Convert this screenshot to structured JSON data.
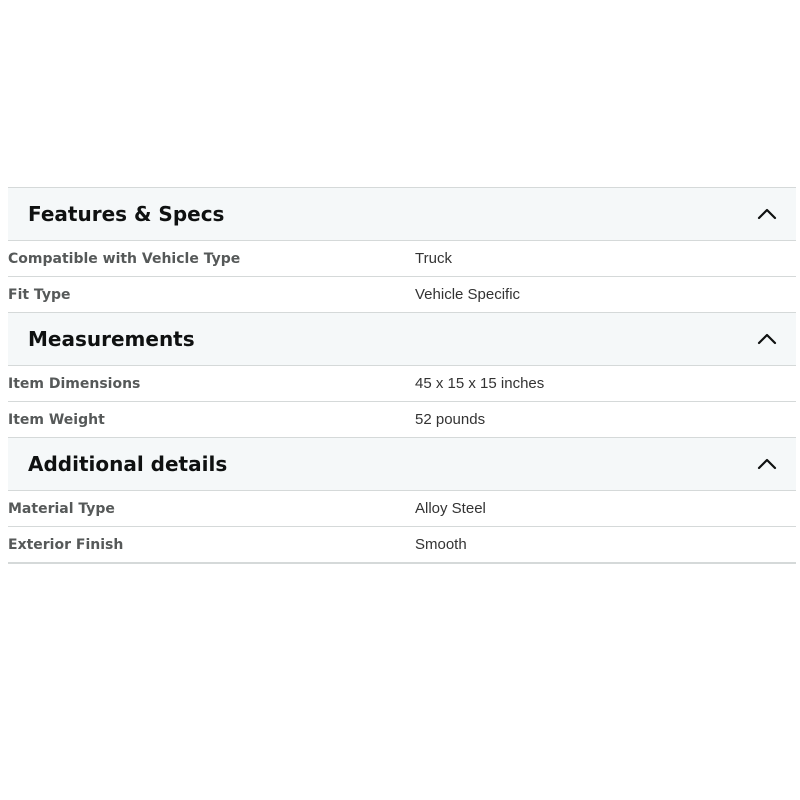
{
  "sections": [
    {
      "title": "Features & Specs",
      "toggle_icon": "chevron-up-icon",
      "rows": [
        {
          "label": "Compatible with Vehicle Type",
          "value": "Truck"
        },
        {
          "label": "Fit Type",
          "value": "Vehicle Specific"
        }
      ]
    },
    {
      "title": "Measurements",
      "toggle_icon": "chevron-up-icon",
      "rows": [
        {
          "label": "Item Dimensions",
          "value": "45 x 15 x 15 inches"
        },
        {
          "label": "Item Weight",
          "value": "52 pounds"
        }
      ]
    },
    {
      "title": "Additional details",
      "toggle_icon": "chevron-up-icon",
      "rows": [
        {
          "label": "Material Type",
          "value": "Alloy Steel"
        },
        {
          "label": "Exterior Finish",
          "value": "Smooth"
        }
      ]
    }
  ],
  "colors": {
    "header_bg": "#f5f8f9",
    "divider": "#d5d9d9",
    "title_text": "#0f1111",
    "label_text": "#565959",
    "value_text": "#333333"
  }
}
